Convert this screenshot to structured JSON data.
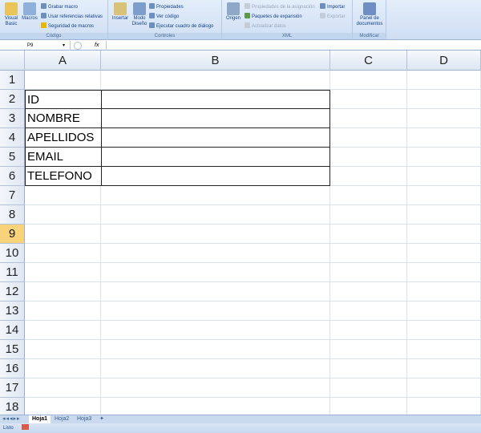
{
  "ribbon": {
    "codigo": {
      "label": "Código",
      "visual_basic": "Visual Basic",
      "macros": "Macros",
      "grabar": "Grabar macro",
      "usar_ref": "Usar referencias relativas",
      "seguridad": "Seguridad de macros"
    },
    "controles": {
      "label": "Controles",
      "insertar": "Insertar",
      "modo": "Modo Diseño",
      "propiedades": "Propiedades",
      "ver_codigo": "Ver código",
      "ejecutar": "Ejecutar cuadro de diálogo"
    },
    "xml": {
      "label": "XML",
      "origen": "Origen",
      "prop_asig": "Propiedades de la asignación",
      "paquetes": "Paquetes de expansión",
      "actualizar": "Actualizar datos",
      "importar": "Importar",
      "exportar": "Exportar"
    },
    "modificar": {
      "label": "Modificar",
      "panel": "Panel de documentos"
    }
  },
  "formula_bar": {
    "name_box": "P9",
    "fx": "fx",
    "value": ""
  },
  "columns": [
    "A",
    "B",
    "C",
    "D"
  ],
  "rows": [
    "1",
    "2",
    "3",
    "4",
    "5",
    "6",
    "7",
    "8",
    "9",
    "10",
    "11",
    "12",
    "13",
    "14",
    "15",
    "16",
    "17",
    "18"
  ],
  "selected_row": "9",
  "cells": {
    "A2": "ID",
    "A3": "NOMBRE",
    "A4": "APELLIDOS",
    "A5": "EMAIL",
    "A6": "TELEFONO"
  },
  "sheets": [
    "Hoja1",
    "Hoja2",
    "Hoja3"
  ],
  "active_sheet": "Hoja1",
  "status": "Listo"
}
